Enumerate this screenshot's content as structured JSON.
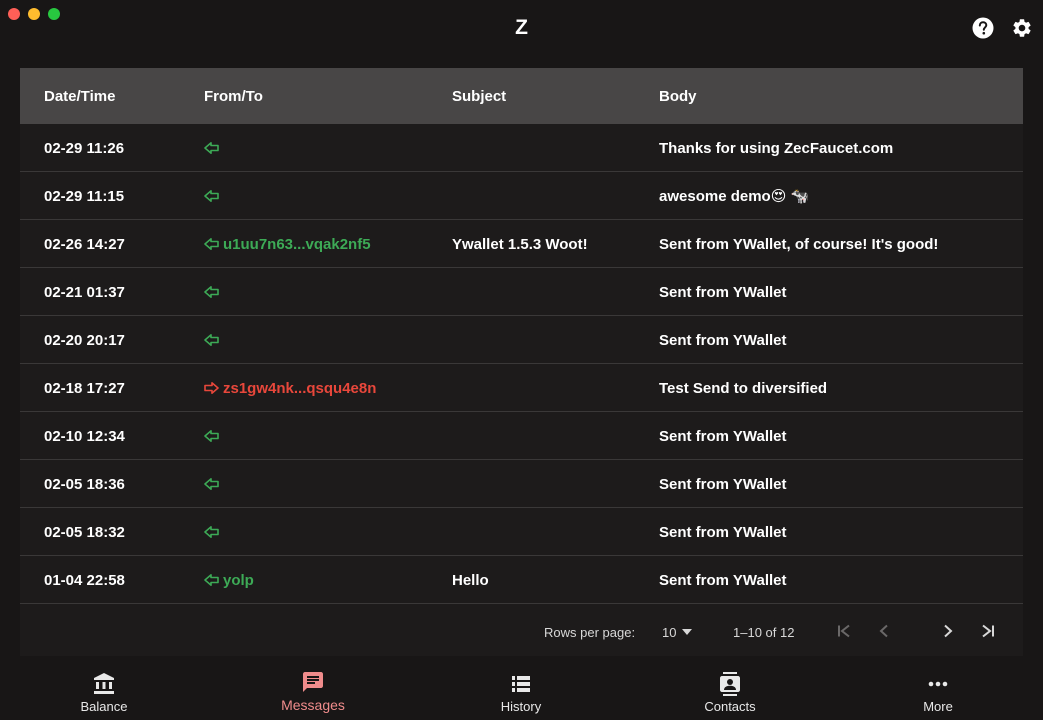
{
  "app": {
    "title": "Z"
  },
  "colors": {
    "incoming": "#3daa56",
    "outgoing": "#e8473b",
    "accent": "#f08c8c",
    "header_bg": "#484646"
  },
  "table": {
    "headers": {
      "date": "Date/Time",
      "from": "From/To",
      "subject": "Subject",
      "body": "Body"
    },
    "rows": [
      {
        "date": "02-29 11:26",
        "direction": "in",
        "address": "",
        "subject": "",
        "body": "Thanks for using ZecFaucet.com"
      },
      {
        "date": "02-29 11:15",
        "direction": "in",
        "address": "",
        "subject": "",
        "body": "awesome demo😍 🐄"
      },
      {
        "date": "02-26 14:27",
        "direction": "in",
        "address": "u1uu7n63...vqak2nf5",
        "subject": "Ywallet 1.5.3 Woot!",
        "body": "Sent from YWallet, of course! It's good!"
      },
      {
        "date": "02-21 01:37",
        "direction": "in",
        "address": "",
        "subject": "",
        "body": "Sent from YWallet"
      },
      {
        "date": "02-20 20:17",
        "direction": "in",
        "address": "",
        "subject": "",
        "body": "Sent from YWallet"
      },
      {
        "date": "02-18 17:27",
        "direction": "out",
        "address": "zs1gw4nk...qsqu4e8n",
        "subject": "",
        "body": "Test Send to diversified"
      },
      {
        "date": "02-10 12:34",
        "direction": "in",
        "address": "",
        "subject": "",
        "body": "Sent from YWallet"
      },
      {
        "date": "02-05 18:36",
        "direction": "in",
        "address": "",
        "subject": "",
        "body": "Sent from YWallet"
      },
      {
        "date": "02-05 18:32",
        "direction": "in",
        "address": "",
        "subject": "",
        "body": "Sent from YWallet"
      },
      {
        "date": "01-04 22:58",
        "direction": "in",
        "address": "yolp",
        "subject": "Hello",
        "body": "Sent from YWallet"
      }
    ]
  },
  "pagination": {
    "rows_per_page_label": "Rows per page:",
    "rows_per_page_value": "10",
    "range_text": "1–10 of 12"
  },
  "nav": {
    "items": [
      {
        "label": "Balance",
        "icon": "bank-icon",
        "active": false
      },
      {
        "label": "Messages",
        "icon": "message-icon",
        "active": true
      },
      {
        "label": "History",
        "icon": "list-icon",
        "active": false
      },
      {
        "label": "Contacts",
        "icon": "contacts-icon",
        "active": false
      },
      {
        "label": "More",
        "icon": "more-icon",
        "active": false
      }
    ]
  }
}
